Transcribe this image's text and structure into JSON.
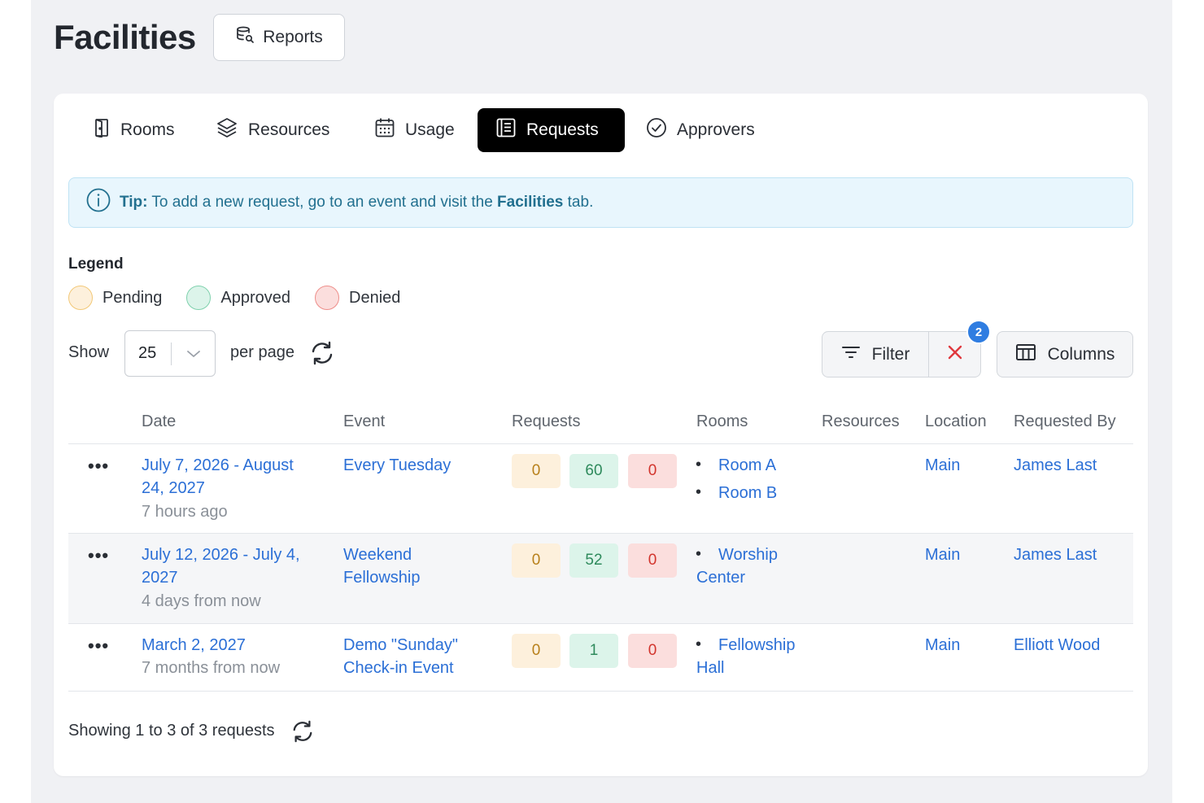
{
  "page": {
    "title": "Facilities",
    "reports_label": "Reports"
  },
  "tabs": [
    {
      "label": "Rooms",
      "icon": "door-icon",
      "active": false
    },
    {
      "label": "Resources",
      "icon": "layers-icon",
      "active": false
    },
    {
      "label": "Usage",
      "icon": "calendar-icon",
      "active": false
    },
    {
      "label": "Requests",
      "icon": "list-box-icon",
      "active": true
    },
    {
      "label": "Approvers",
      "icon": "check-circle-icon",
      "active": false
    }
  ],
  "tip": {
    "label": "Tip:",
    "text": " To add a new request, go to an event and visit the ",
    "emphasis": "Facilities",
    "suffix": " tab."
  },
  "legend": {
    "title": "Legend",
    "items": [
      {
        "label": "Pending",
        "fill": "#fdf0dc",
        "border": "#f2c877"
      },
      {
        "label": "Approved",
        "fill": "#dcf4ea",
        "border": "#7fd1ad"
      },
      {
        "label": "Denied",
        "fill": "#fbdedd",
        "border": "#ee8e8a"
      }
    ]
  },
  "pagination": {
    "show_label": "Show",
    "per_page_value": "25",
    "per_page_label": "per page"
  },
  "toolbar": {
    "filter_label": "Filter",
    "filter_count": "2",
    "columns_label": "Columns"
  },
  "table": {
    "columns": [
      "Date",
      "Event",
      "Requests",
      "Rooms",
      "Resources",
      "Location",
      "Requested By"
    ],
    "rows": [
      {
        "date_line1": "July 7, 2026 - August",
        "date_line2": "24, 2027",
        "relative": "7 hours ago",
        "event_line1": "Every Tuesday",
        "event_line2": "",
        "pending": "0",
        "approved": "60",
        "denied": "0",
        "rooms": [
          "Room A",
          "Room B"
        ],
        "location": "Main",
        "requested_by": "James Last"
      },
      {
        "date_line1": "July 12, 2026 - July 4,",
        "date_line2": "2027",
        "relative": "4 days from now",
        "event_line1": "Weekend",
        "event_line2": "Fellowship",
        "pending": "0",
        "approved": "52",
        "denied": "0",
        "rooms_line1": "Worship",
        "rooms_line2": "Center",
        "location": "Main",
        "requested_by": "James Last"
      },
      {
        "date_line1": "March 2, 2027",
        "relative": "7 months from now",
        "event_line1": "Demo \"Sunday\"",
        "event_line2": "Check-in Event",
        "pending": "0",
        "approved": "1",
        "denied": "0",
        "rooms_line1": "Fellowship",
        "rooms_line2": "Hall",
        "location": "Main",
        "requested_by": "Elliott Wood"
      }
    ]
  },
  "footer": {
    "summary": "Showing 1 to 3 of 3 requests"
  }
}
